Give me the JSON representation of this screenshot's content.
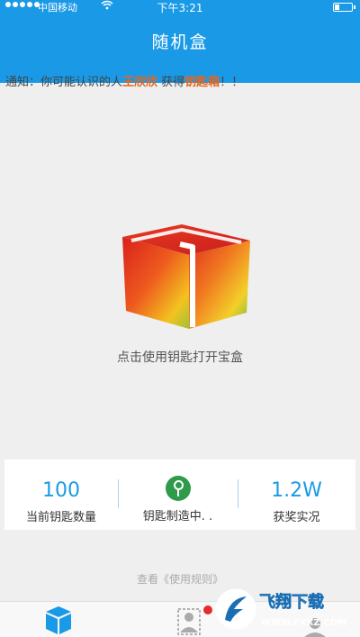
{
  "status_bar": {
    "carrier": "中国移动",
    "time": "下午3:21"
  },
  "header": {
    "title": "随机盒"
  },
  "notice": {
    "prefix": "通知：你可能认识的人",
    "name": "王欣欣",
    "middle": " 获得",
    "item": "钥匙箱",
    "suffix": "！！"
  },
  "box": {
    "caption": "点击使用钥匙打开宝盒"
  },
  "stats": {
    "keys_count": "100",
    "keys_label": "当前钥匙数量",
    "making_label": "钥匙制造中. .",
    "awards_count": "1.2W",
    "awards_label": "获奖实况"
  },
  "rules_link": "查看《使用规则》",
  "tabs": [
    {
      "icon": "box-icon"
    },
    {
      "icon": "user-icon"
    },
    {
      "icon": "profile-icon"
    }
  ],
  "watermark": {
    "brand": "飞翔下载",
    "url": "WWW.FXXZ.COM"
  },
  "colors": {
    "brand": "#1a9ae6",
    "highlight": "#e8641a",
    "key_green": "#2e9a4a"
  }
}
